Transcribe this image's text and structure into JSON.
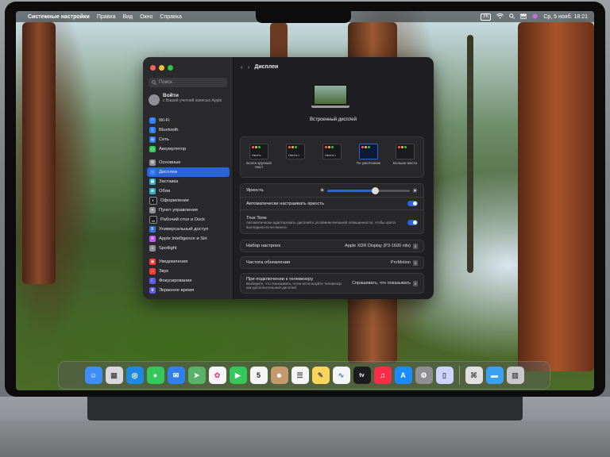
{
  "menubar": {
    "apple": "",
    "app": "Системные настройки",
    "menus": [
      "Правка",
      "Вид",
      "Окно",
      "Справка"
    ],
    "input_source": "УК",
    "datetime": "Ср, 5 нояб. 18:21"
  },
  "sidebar": {
    "search_placeholder": "Поиск",
    "account": {
      "title": "Войти",
      "subtitle": "с Вашей учетной записью Apple"
    },
    "items": [
      {
        "label": "Wi-Fi",
        "icon": "wifi-icon",
        "color": "#2e7cf6"
      },
      {
        "label": "Bluetooth",
        "icon": "bluetooth-icon",
        "color": "#2e7cf6"
      },
      {
        "label": "Сеть",
        "icon": "network-icon",
        "color": "#2e7cf6"
      },
      {
        "label": "Аккумулятор",
        "icon": "battery-icon",
        "color": "#34c759"
      },
      {
        "label": "Основные",
        "icon": "gear-icon",
        "color": "#8e8e93"
      },
      {
        "label": "Дисплеи",
        "icon": "display-icon",
        "color": "#2e7cf6",
        "selected": true
      },
      {
        "label": "Заставка",
        "icon": "screensaver-icon",
        "color": "#30b0c7"
      },
      {
        "label": "Обои",
        "icon": "wallpaper-icon",
        "color": "#30b0c7"
      },
      {
        "label": "Оформление",
        "icon": "appearance-icon",
        "color": "#1c1c1e"
      },
      {
        "label": "Пункт управления",
        "icon": "control-center-icon",
        "color": "#8e8e93"
      },
      {
        "label": "Рабочий стол и Dock",
        "icon": "dock-icon",
        "color": "#1c1c1e"
      },
      {
        "label": "Универсальный доступ",
        "icon": "accessibility-icon",
        "color": "#2e7cf6"
      },
      {
        "label": "Apple Intelligence и Siri",
        "icon": "siri-icon",
        "color": "#bf5af2"
      },
      {
        "label": "Spotlight",
        "icon": "spotlight-icon",
        "color": "#8e8e93"
      },
      {
        "label": "Уведомления",
        "icon": "notifications-icon",
        "color": "#ff3b30"
      },
      {
        "label": "Звук",
        "icon": "sound-icon",
        "color": "#ff3b30"
      },
      {
        "label": "Фокусирование",
        "icon": "focus-icon",
        "color": "#5e5ce6"
      },
      {
        "label": "Экранное время",
        "icon": "screen-time-icon",
        "color": "#5e5ce6"
      }
    ]
  },
  "content": {
    "title": "Дисплеи",
    "display_name": "Встроенный дисплей",
    "resolutions": [
      {
        "sample": "Here's",
        "label": "Более крупный текст",
        "selected": false
      },
      {
        "sample": "Here's t",
        "label": "",
        "selected": false
      },
      {
        "sample": "Here's t",
        "label": "",
        "selected": false
      },
      {
        "sample": "",
        "label": "По умолчанию",
        "selected": true
      },
      {
        "sample": "",
        "label": "Больше места",
        "selected": false
      }
    ],
    "brightness": {
      "label": "Яркость",
      "level": 0.58
    },
    "auto_brightness": {
      "label": "Автоматически настраивать яркость",
      "on": true
    },
    "true_tone": {
      "label": "True Tone",
      "description": "Автоматически адаптировать дисплей к условиям внешней освещенности, чтобы цвета выглядели естественно.",
      "on": true
    },
    "preset": {
      "label": "Набор настроек",
      "value": "Apple XDR Display (P3-1600 nits)"
    },
    "refresh_rate": {
      "label": "Частота обновления",
      "value": "ProMotion"
    },
    "tv": {
      "label": "При подключении к телевизору",
      "description": "Выберите, что показывать, если используйте телевизор как дополнительный дисплей.",
      "value": "Спрашивать, что показывать"
    }
  },
  "dock": {
    "items": [
      {
        "name": "finder-icon",
        "color": "#3e8ef7",
        "glyph": "☺"
      },
      {
        "name": "launchpad-icon",
        "color": "#d8d8dc",
        "glyph": "▦"
      },
      {
        "name": "safari-icon",
        "color": "#1e88e5",
        "glyph": "◎"
      },
      {
        "name": "messages-icon",
        "color": "#34c759",
        "glyph": "●"
      },
      {
        "name": "mail-icon",
        "color": "#2f80ed",
        "glyph": "✉"
      },
      {
        "name": "maps-icon",
        "color": "#58b368",
        "glyph": "➤"
      },
      {
        "name": "photos-icon",
        "color": "#f5f5f5",
        "glyph": "✿"
      },
      {
        "name": "facetime-icon",
        "color": "#34c759",
        "glyph": "▶"
      },
      {
        "name": "calendar-icon",
        "color": "#f5f5f5",
        "glyph": "5"
      },
      {
        "name": "contacts-icon",
        "color": "#c49a6c",
        "glyph": "☻"
      },
      {
        "name": "reminders-icon",
        "color": "#f5f5f5",
        "glyph": "☰"
      },
      {
        "name": "notes-icon",
        "color": "#fbd65a",
        "glyph": "✎"
      },
      {
        "name": "freeform-icon",
        "color": "#f5f5f5",
        "glyph": "∿"
      },
      {
        "name": "apple-tv-icon",
        "color": "#1c1c1e",
        "glyph": "tv"
      },
      {
        "name": "music-icon",
        "color": "#fa2d48",
        "glyph": "♫"
      },
      {
        "name": "app-store-icon",
        "color": "#1a8cff",
        "glyph": "A"
      },
      {
        "name": "system-settings-icon",
        "color": "#8e8e93",
        "glyph": "⚙"
      },
      {
        "name": "iphone-mirroring-icon",
        "color": "#cfd4ff",
        "glyph": "▯"
      }
    ],
    "trailing": [
      {
        "name": "preview-icon",
        "color": "#e0e0e0",
        "glyph": "⌘"
      },
      {
        "name": "downloads-folder-icon",
        "color": "#3aa0f0",
        "glyph": "▬"
      },
      {
        "name": "trash-icon",
        "color": "#c8c8cc",
        "glyph": "🗑"
      }
    ]
  }
}
